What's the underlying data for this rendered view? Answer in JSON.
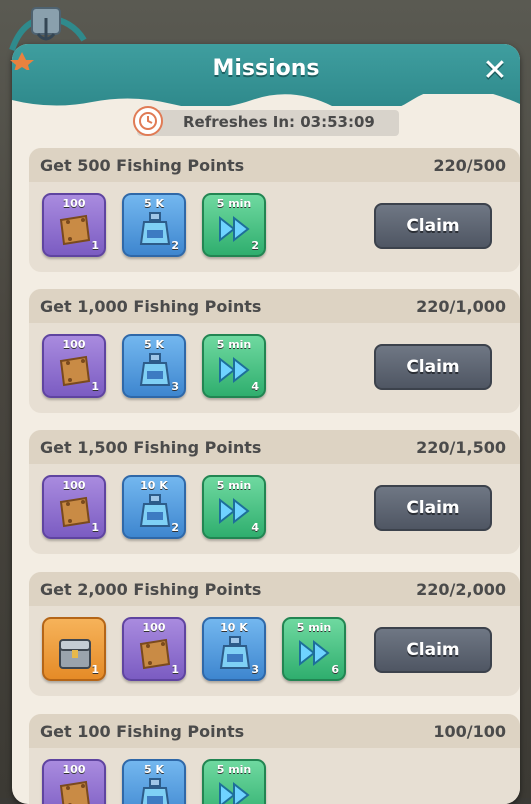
{
  "header": {
    "title": "Missions",
    "close_icon": "close-icon"
  },
  "refresh": {
    "text": "Refreshes In: 03:53:09",
    "icon": "clock-icon"
  },
  "colors": {
    "header_teal": "#2f8a8c",
    "panel_bg": "#f3ede3",
    "claim_gray": "#5a6170"
  },
  "missions": [
    {
      "title": "Get 500 Fishing Points",
      "progress": "220/500",
      "claim_label": "Claim",
      "rewards": [
        {
          "type": "scroll",
          "label": "100",
          "count": "1"
        },
        {
          "type": "exp-potion",
          "label": "5 K",
          "count": "2"
        },
        {
          "type": "speedup",
          "label": "5 min",
          "count": "2"
        }
      ]
    },
    {
      "title": "Get 1,000 Fishing Points",
      "progress": "220/1,000",
      "claim_label": "Claim",
      "rewards": [
        {
          "type": "scroll",
          "label": "100",
          "count": "1"
        },
        {
          "type": "exp-potion",
          "label": "5 K",
          "count": "3"
        },
        {
          "type": "speedup",
          "label": "5 min",
          "count": "4"
        }
      ]
    },
    {
      "title": "Get 1,500 Fishing Points",
      "progress": "220/1,500",
      "claim_label": "Claim",
      "rewards": [
        {
          "type": "scroll",
          "label": "100",
          "count": "1"
        },
        {
          "type": "exp-potion",
          "label": "10 K",
          "count": "2"
        },
        {
          "type": "speedup",
          "label": "5 min",
          "count": "4"
        }
      ]
    },
    {
      "title": "Get 2,000 Fishing Points",
      "progress": "220/2,000",
      "claim_label": "Claim",
      "rewards": [
        {
          "type": "chest",
          "label": "",
          "count": "1"
        },
        {
          "type": "scroll",
          "label": "100",
          "count": "1"
        },
        {
          "type": "exp-potion",
          "label": "10 K",
          "count": "3"
        },
        {
          "type": "speedup",
          "label": "5 min",
          "count": "6"
        }
      ]
    },
    {
      "title": "Get 100 Fishing Points",
      "progress": "100/100",
      "claim_label": "",
      "rewards": [
        {
          "type": "scroll",
          "label": "100",
          "count": ""
        },
        {
          "type": "exp-potion",
          "label": "5 K",
          "count": ""
        },
        {
          "type": "speedup",
          "label": "5 min",
          "count": ""
        }
      ]
    }
  ]
}
